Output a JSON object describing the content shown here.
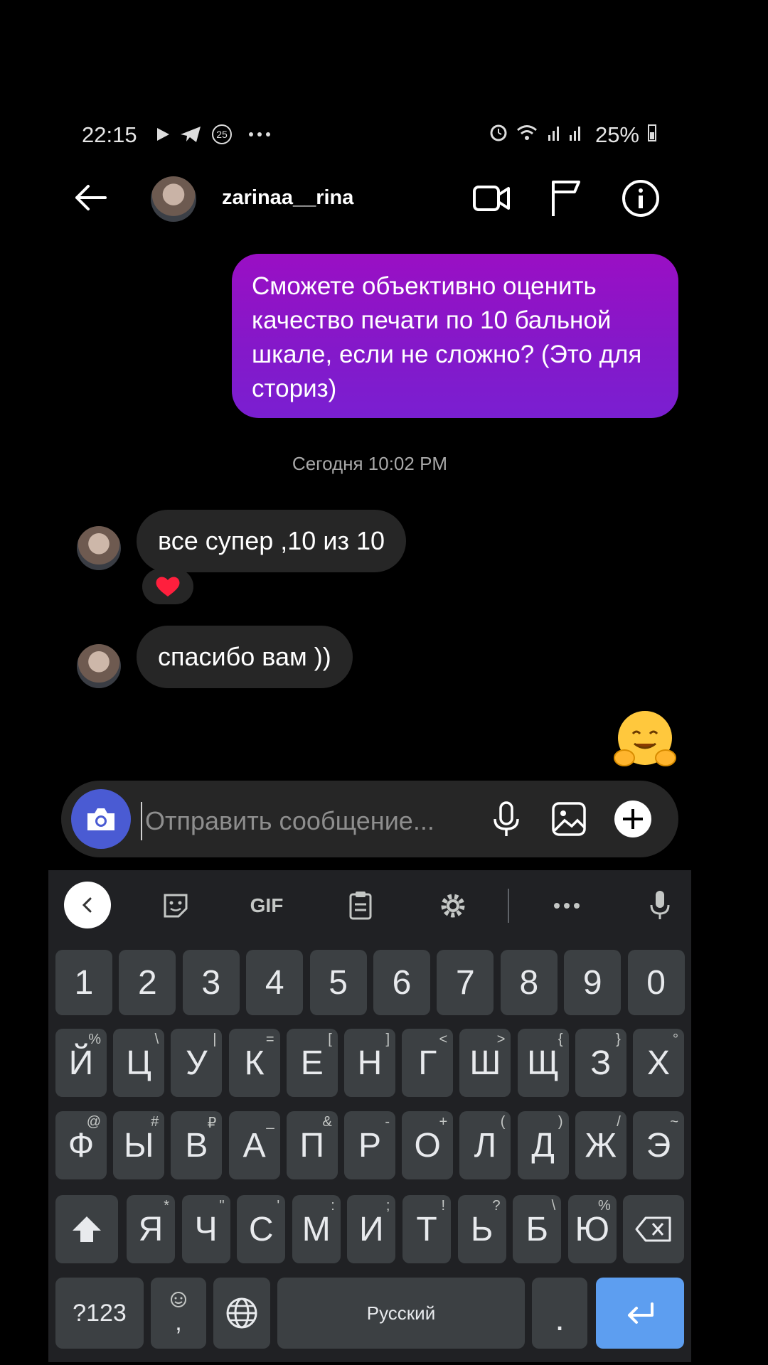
{
  "status_bar": {
    "time": "22:15",
    "badge": "25",
    "battery": "25%"
  },
  "header": {
    "username": "zarinaa__rina"
  },
  "messages": {
    "outgoing_1": "Сможете объективно оценить качество печати по 10 бальной шкале, если не сложно? (Это для сториз)",
    "timestamp": "Сегодня 10:02 PM",
    "incoming_1": "все супер ,10 из 10",
    "incoming_2": "спасибо вам ))",
    "reaction_icon": "heart-icon",
    "sent_emoji_icon": "hugging-face-icon"
  },
  "composer": {
    "placeholder": "Отправить сообщение..."
  },
  "keyboard": {
    "toolbar": {
      "gif": "GIF"
    },
    "row_numbers": [
      "1",
      "2",
      "3",
      "4",
      "5",
      "6",
      "7",
      "8",
      "9",
      "0"
    ],
    "row1": [
      [
        "Й",
        "%"
      ],
      [
        "Ц",
        "\\"
      ],
      [
        "У",
        "|"
      ],
      [
        "К",
        "="
      ],
      [
        "Е",
        "["
      ],
      [
        "Н",
        "]"
      ],
      [
        "Г",
        "<"
      ],
      [
        "Ш",
        ">"
      ],
      [
        "Щ",
        "{"
      ],
      [
        "З",
        "}"
      ],
      [
        "Х",
        "°"
      ]
    ],
    "row2": [
      [
        "Ф",
        "@"
      ],
      [
        "Ы",
        "#"
      ],
      [
        "В",
        "₽"
      ],
      [
        "А",
        "_"
      ],
      [
        "П",
        "&"
      ],
      [
        "Р",
        "-"
      ],
      [
        "О",
        "+"
      ],
      [
        "Л",
        "("
      ],
      [
        "Д",
        ")"
      ],
      [
        "Ж",
        "/"
      ],
      [
        "Э",
        "~"
      ]
    ],
    "row3": [
      [
        "Я",
        "*"
      ],
      [
        "Ч",
        "\""
      ],
      [
        "С",
        "'"
      ],
      [
        "М",
        ":"
      ],
      [
        "И",
        ";"
      ],
      [
        "Т",
        "!"
      ],
      [
        "Ь",
        "?"
      ],
      [
        "Б",
        "\\"
      ],
      [
        "Ю",
        "%"
      ]
    ],
    "symbols_key": "?123",
    "comma_key": ",",
    "space_label": "Русский",
    "period_key": ".",
    "colors": {
      "enter": "#5d9ef0",
      "bubble_out": "#8a14c8",
      "camera": "#4a5bd3"
    }
  }
}
